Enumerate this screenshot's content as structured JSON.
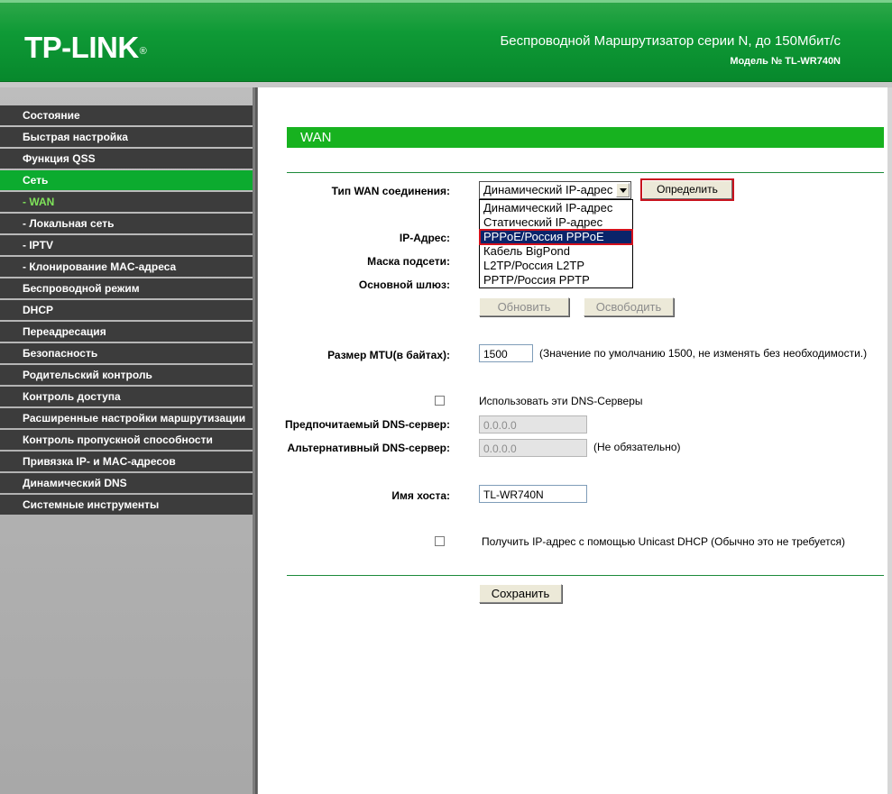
{
  "header": {
    "logo": "TP-LINK",
    "logo_reg": "®",
    "product_title": "Беспроводной Маршрутизатор серии N, до 150Мбит/с",
    "model_line": "Модель № TL-WR740N"
  },
  "sidebar": {
    "items": [
      {
        "label": "Состояние"
      },
      {
        "label": "Быстрая настройка"
      },
      {
        "label": "Функция QSS"
      },
      {
        "label": "Сеть"
      },
      {
        "label": "- WAN"
      },
      {
        "label": "- Локальная сеть"
      },
      {
        "label": "- IPTV"
      },
      {
        "label": "- Клонирование MAC-адреса"
      },
      {
        "label": "Беспроводной режим"
      },
      {
        "label": "DHCP"
      },
      {
        "label": "Переадресация"
      },
      {
        "label": "Безопасность"
      },
      {
        "label": "Родительский контроль"
      },
      {
        "label": "Контроль доступа"
      },
      {
        "label": "Расширенные настройки маршрутизации"
      },
      {
        "label": "Контроль пропускной способности"
      },
      {
        "label": "Привязка IP- и MAC-адресов"
      },
      {
        "label": "Динамический DNS"
      },
      {
        "label": "Системные инструменты"
      }
    ]
  },
  "page": {
    "section_title": "WAN",
    "wan_type_label": "Тип WAN соединения:",
    "wan_type_value": "Динамический IP-адрес",
    "wan_type_options": [
      "Динамический IP-адрес",
      "Статический IP-адрес",
      "PPPoE/Россия PPPoE",
      "Кабель BigPond",
      "L2TP/Россия L2TP",
      "PPTP/Россия PPTP"
    ],
    "detect_button": "Определить",
    "ip_label": "IP-Адрес:",
    "mask_label": "Маска подсети:",
    "gateway_label": "Основной шлюз:",
    "renew_button": "Обновить",
    "release_button": "Освободить",
    "mtu_label": "Размер MTU(в байтах):",
    "mtu_value": "1500",
    "mtu_hint": "(Значение по умолчанию 1500, не изменять без необходимости.)",
    "use_dns_label": "Использовать эти DNS-Серверы",
    "primary_dns_label": "Предпочитаемый DNS-сервер:",
    "primary_dns_value": "0.0.0.0",
    "secondary_dns_label": "Альтернативный DNS-сервер:",
    "secondary_dns_value": "0.0.0.0",
    "secondary_dns_hint": "(Не обязательно)",
    "hostname_label": "Имя хоста:",
    "hostname_value": "TL-WR740N",
    "unicast_label": "Получить IP-адрес с помощью Unicast DHCP (Обычно это не требуется)",
    "save_button": "Сохранить"
  },
  "colors": {
    "header_green": "#0f9a36",
    "menu_active": "#0cab2f",
    "menu_bg": "#3c3c3c",
    "section_bar": "#17b21f",
    "highlight_red": "#c8131e",
    "selection_blue": "#0a246a"
  }
}
